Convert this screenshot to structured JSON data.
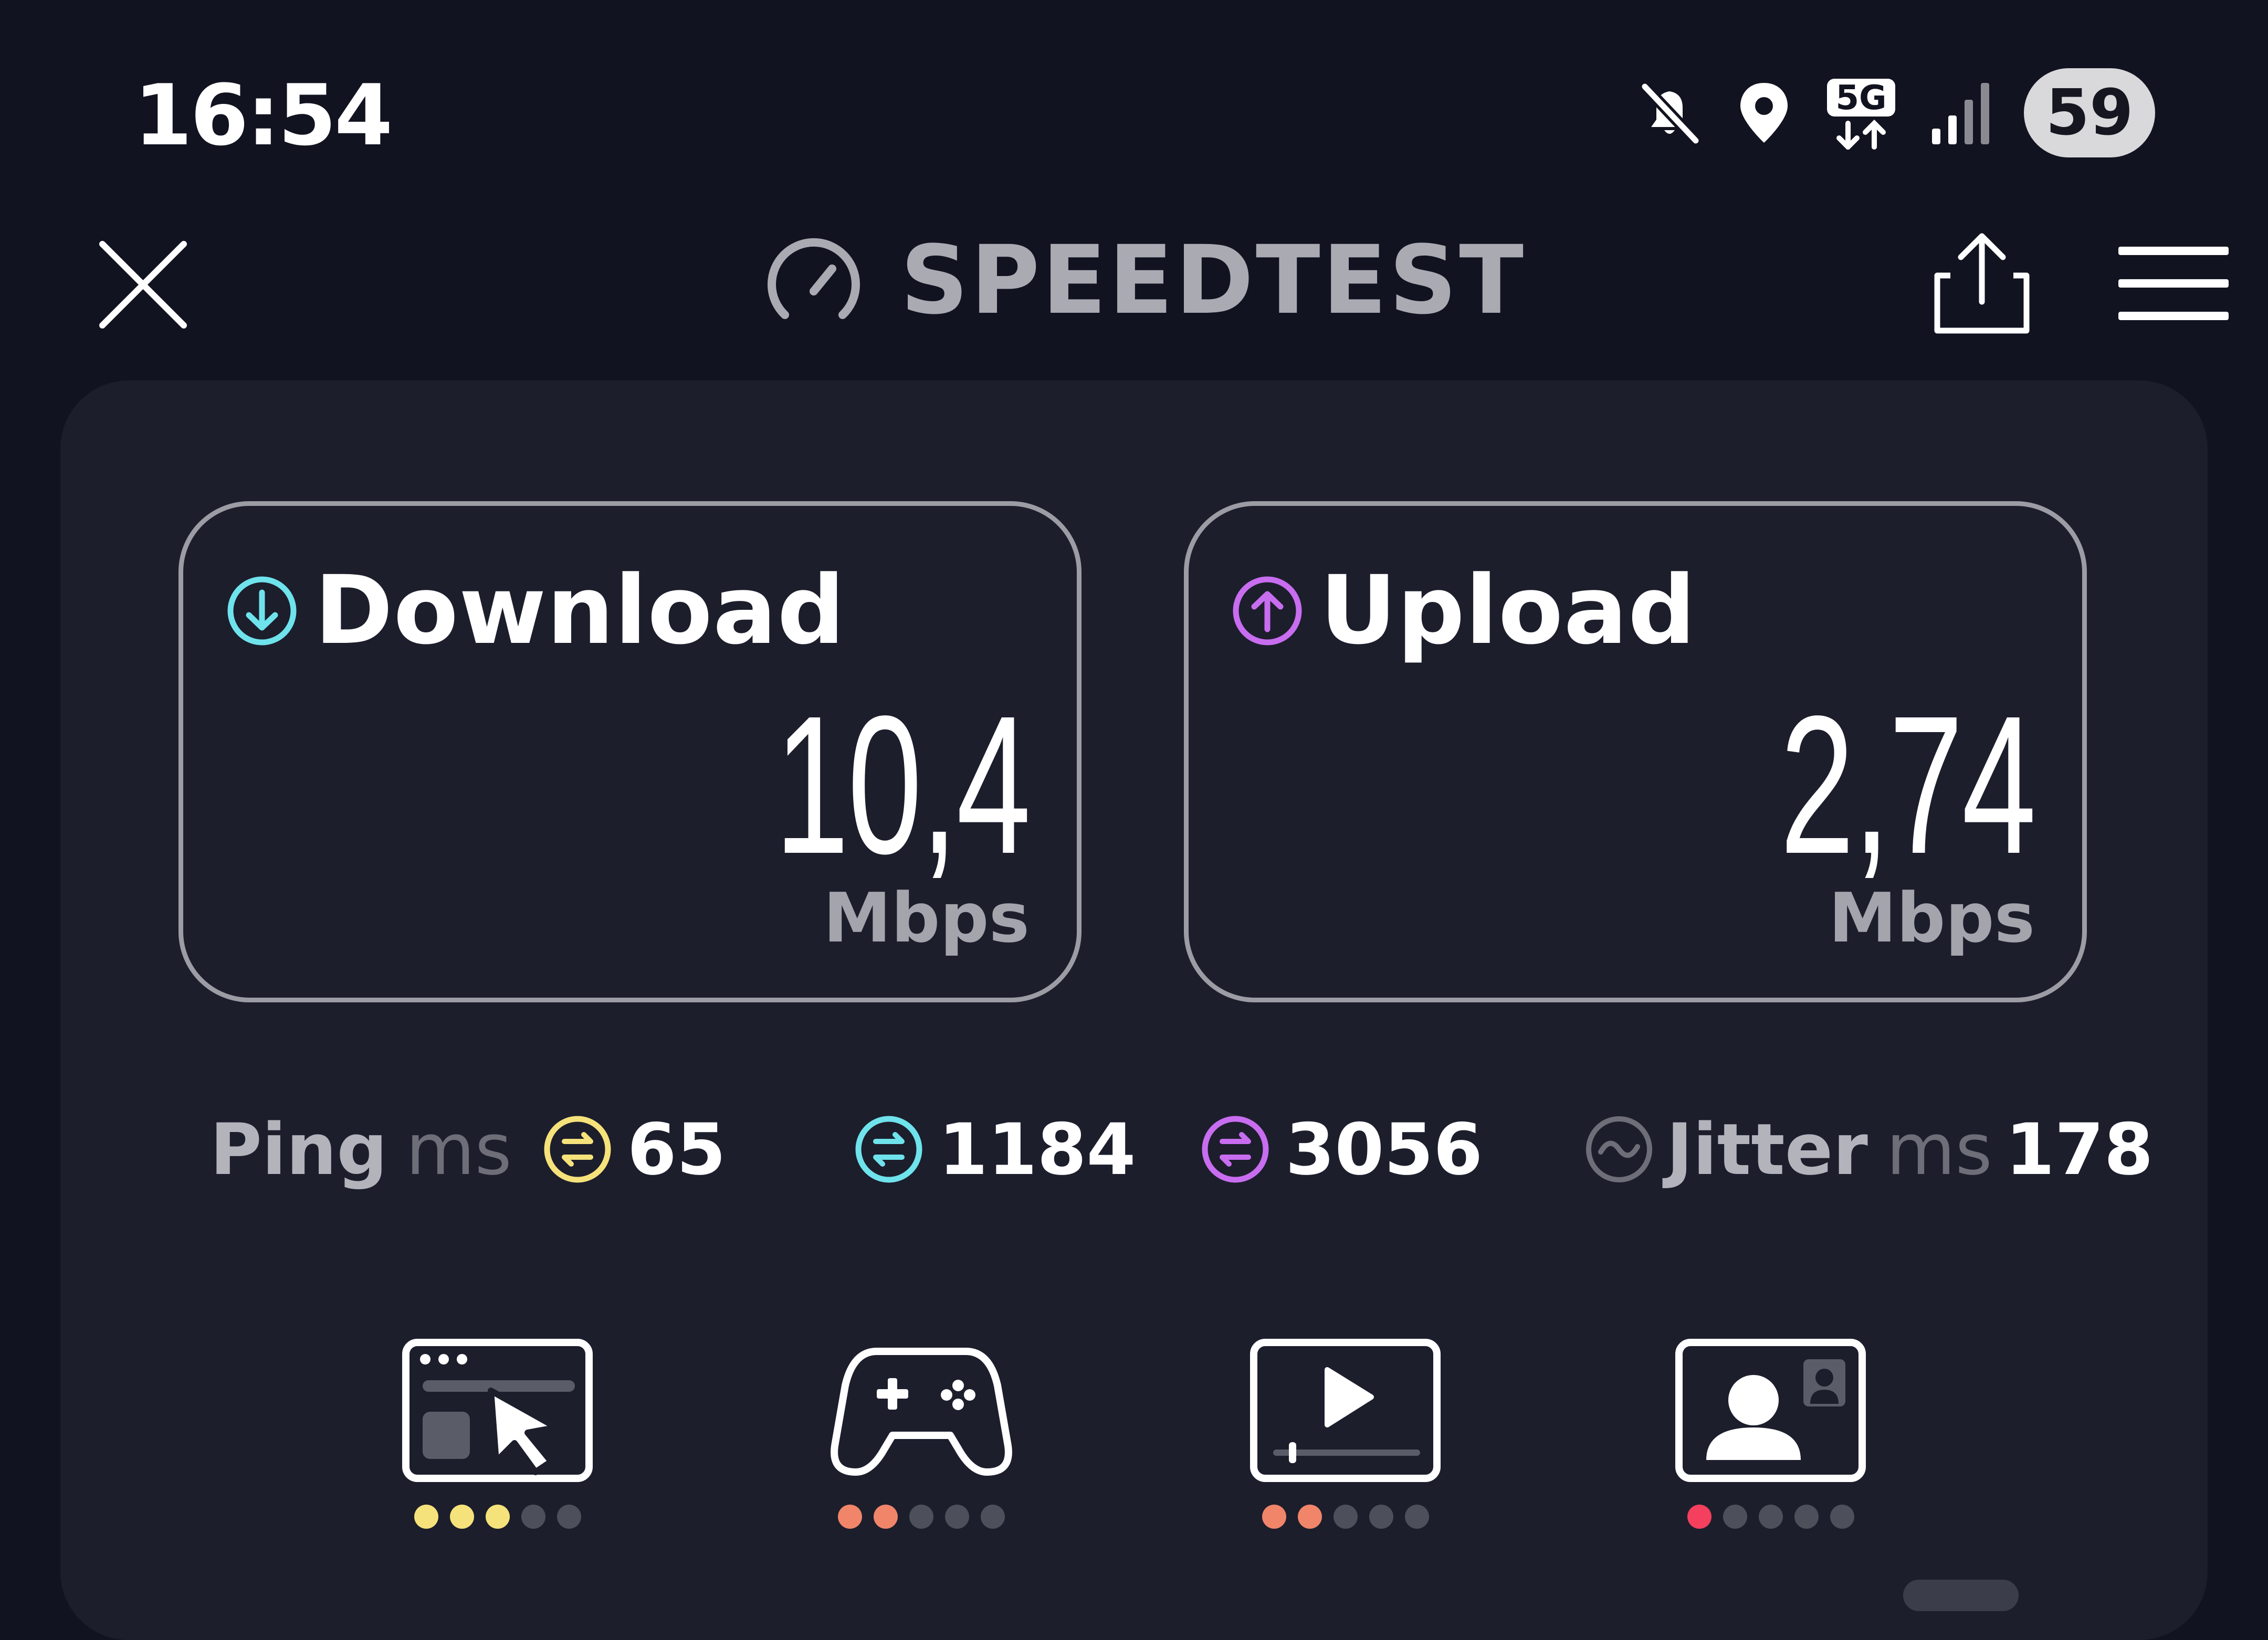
{
  "status_bar": {
    "time": "16:54",
    "network": "5G",
    "battery": "59",
    "icons": [
      "mute-icon",
      "location-icon",
      "network-5g-icon",
      "signal-icon",
      "battery-icon"
    ]
  },
  "header": {
    "title": "SPEEDTEST",
    "icons": [
      "close-icon",
      "speedometer-icon",
      "share-icon",
      "menu-icon"
    ]
  },
  "download": {
    "label": "Download",
    "value": "10,4",
    "unit": "Mbps",
    "accent": "#6fe3ec"
  },
  "upload": {
    "label": "Upload",
    "value": "2,74",
    "unit": "Mbps",
    "accent": "#c86df0"
  },
  "metrics": {
    "ping_label": "Ping",
    "ping_unit": "ms",
    "ping_idle": "65",
    "ping_download": "1184",
    "ping_upload": "3056",
    "jitter_label": "Jitter",
    "jitter_unit": "ms",
    "jitter_value": "178",
    "colors": {
      "idle": "#f6e27a",
      "download": "#6fe3ec",
      "upload": "#c86df0",
      "jitter": "#6d6e78"
    }
  },
  "quality": [
    {
      "icon": "web-browsing-icon",
      "rating": 3,
      "max": 5,
      "color": "#f6e27a"
    },
    {
      "icon": "gaming-icon",
      "rating": 2,
      "max": 5,
      "color": "#f0856a"
    },
    {
      "icon": "video-streaming-icon",
      "rating": 2,
      "max": 5,
      "color": "#f0856a"
    },
    {
      "icon": "video-call-icon",
      "rating": 1,
      "max": 5,
      "color": "#f43f5e"
    }
  ]
}
